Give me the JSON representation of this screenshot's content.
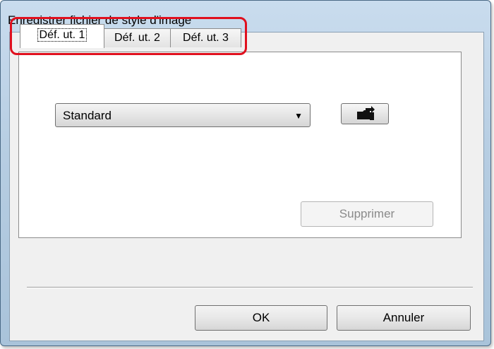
{
  "window": {
    "title": "Enregistrer fichier de style d'image"
  },
  "tabs": [
    {
      "label": "Déf. ut. 1",
      "active": true
    },
    {
      "label": "Déf. ut. 2",
      "active": false
    },
    {
      "label": "Déf. ut. 3",
      "active": false
    }
  ],
  "style_select": {
    "value": "Standard"
  },
  "icons": {
    "browse": "folder-swap-icon",
    "dropdown": "chevron-down-icon"
  },
  "buttons": {
    "delete": "Supprimer",
    "ok": "OK",
    "cancel": "Annuler"
  },
  "colors": {
    "highlight": "#e0101e",
    "frame": "#b6cde2"
  }
}
